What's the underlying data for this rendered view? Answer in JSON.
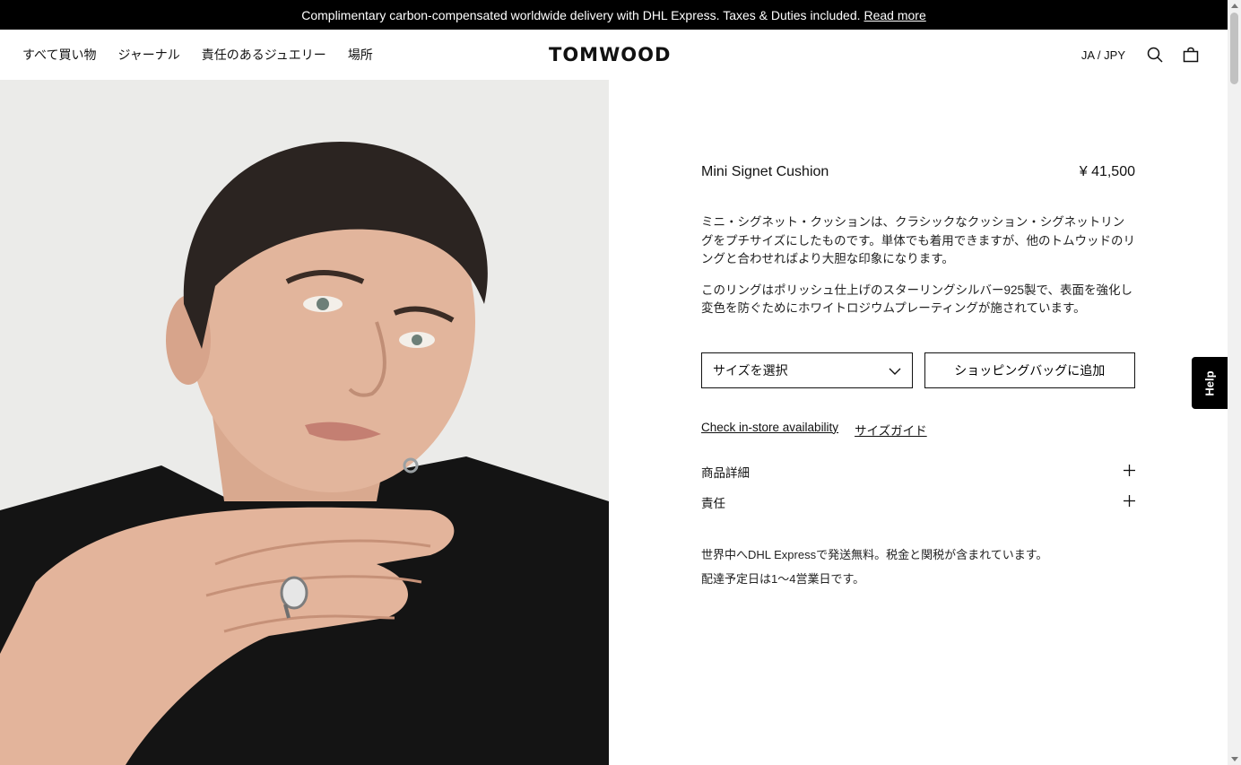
{
  "announcement": {
    "text": "Complimentary carbon-compensated worldwide delivery with DHL Express. Taxes & Duties included.",
    "link": "Read more"
  },
  "nav": {
    "shop_all": "すべて買い物",
    "journal": "ジャーナル",
    "responsible": "責任のあるジュエリー",
    "locations": "場所"
  },
  "brand": {
    "logo": "TOMWOOD"
  },
  "header_right": {
    "locale": "JA / JPY",
    "search_icon": "search-icon",
    "bag_icon": "shopping-bag-icon"
  },
  "product": {
    "name": "Mini Signet Cushion",
    "price": "¥ 41,500",
    "description_1": "ミニ・シグネット・クッションは、クラシックなクッション・シグネットリングをプチサイズにしたものです。単体でも着用できますが、他のトムウッドのリングと合わせればより大胆な印象になります。",
    "description_2": "このリングはポリッシュ仕上げのスターリングシルバー925製で、表面を強化し変色を防ぐためにホワイトロジウムプレーティングが施されています。",
    "size_select": "サイズを選択",
    "add_to_bag": "ショッピングバッグに追加",
    "store_availability": "Check in-store availability",
    "size_guide": "サイズガイド",
    "accordion_details": "商品詳細",
    "accordion_responsibility": "責任",
    "shipping_1": "世界中へDHL Expressで発送無料。税金と関税が含まれています。",
    "shipping_2": "配達予定日は1〜4営業日です。"
  },
  "help": {
    "label": "Help"
  },
  "colors": {
    "announcement_bg": "#000000",
    "text": "#111111",
    "background": "#ffffff"
  }
}
